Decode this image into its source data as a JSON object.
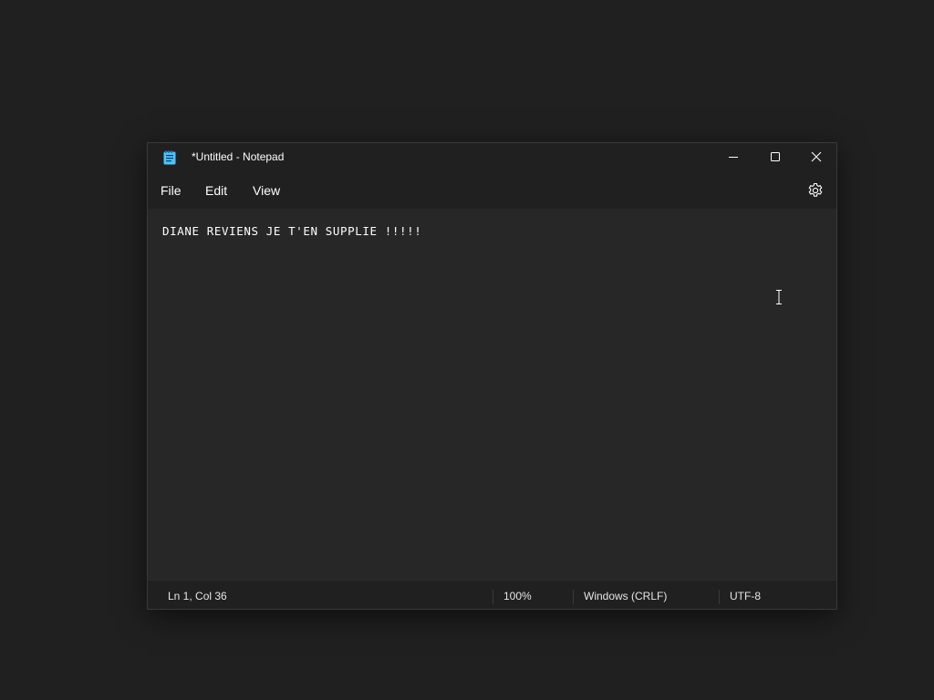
{
  "window": {
    "title": "*Untitled - Notepad",
    "app_icon": "notepad-icon",
    "controls": {
      "minimize_icon": "minimize-icon",
      "maximize_icon": "maximize-icon",
      "close_icon": "close-icon"
    }
  },
  "menu": {
    "items": [
      {
        "label": "File"
      },
      {
        "label": "Edit"
      },
      {
        "label": "View"
      }
    ],
    "settings_icon": "gear-icon"
  },
  "editor": {
    "content": "DIANE REVIENS JE T'EN SUPPLIE !!!!!"
  },
  "status": {
    "position": "Ln 1, Col 36",
    "zoom": "100%",
    "line_ending": "Windows (CRLF)",
    "encoding": "UTF-8"
  },
  "colors": {
    "desktop_bg": "#202020",
    "chrome_bg": "#202020",
    "editor_bg": "#272727",
    "app_icon_accent": "#4cc2ff"
  }
}
